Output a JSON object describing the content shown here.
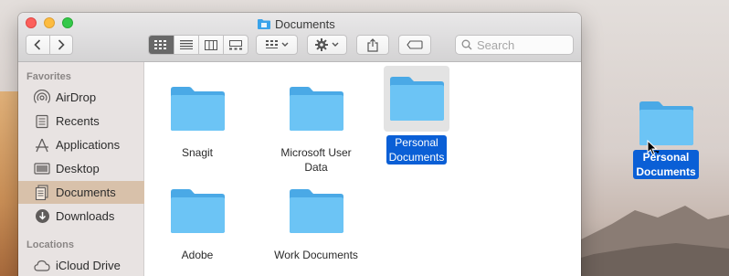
{
  "window": {
    "title": "Documents"
  },
  "toolbar": {
    "back_icon": "chevron-left-icon",
    "forward_icon": "chevron-right-icon",
    "views": [
      "icon-view-icon",
      "list-view-icon",
      "column-view-icon",
      "gallery-view-icon"
    ],
    "active_view": "icon-view-icon",
    "group_icon": "group-by-icon",
    "action_icon": "gear-icon",
    "share_icon": "share-icon",
    "tags_icon": "tag-icon",
    "search_placeholder": "Search"
  },
  "sidebar": {
    "sections": [
      {
        "title": "Favorites",
        "items": [
          {
            "label": "AirDrop",
            "icon": "airdrop-icon"
          },
          {
            "label": "Recents",
            "icon": "recents-icon"
          },
          {
            "label": "Applications",
            "icon": "applications-icon"
          },
          {
            "label": "Desktop",
            "icon": "desktop-icon"
          },
          {
            "label": "Documents",
            "icon": "documents-icon",
            "selected": true
          },
          {
            "label": "Downloads",
            "icon": "downloads-icon"
          }
        ]
      },
      {
        "title": "Locations",
        "items": [
          {
            "label": "iCloud Drive",
            "icon": "cloud-icon"
          }
        ]
      }
    ]
  },
  "files": [
    {
      "label": "Snagit",
      "icon": "folder-icon"
    },
    {
      "label": "Microsoft User\nData",
      "icon": "folder-icon"
    },
    {
      "label": "Personal\nDocuments",
      "icon": "folder-icon",
      "selected": true
    },
    {
      "label": "Adobe",
      "icon": "folder-icon"
    },
    {
      "label": "Work Documents",
      "icon": "folder-icon"
    }
  ],
  "desktop_file": {
    "label": "Personal\nDocuments",
    "icon": "folder-icon"
  },
  "colors": {
    "selection": "#0a5fd6",
    "folder": "#5ab8f0",
    "sidebar_selected": "#d8c1aa"
  }
}
